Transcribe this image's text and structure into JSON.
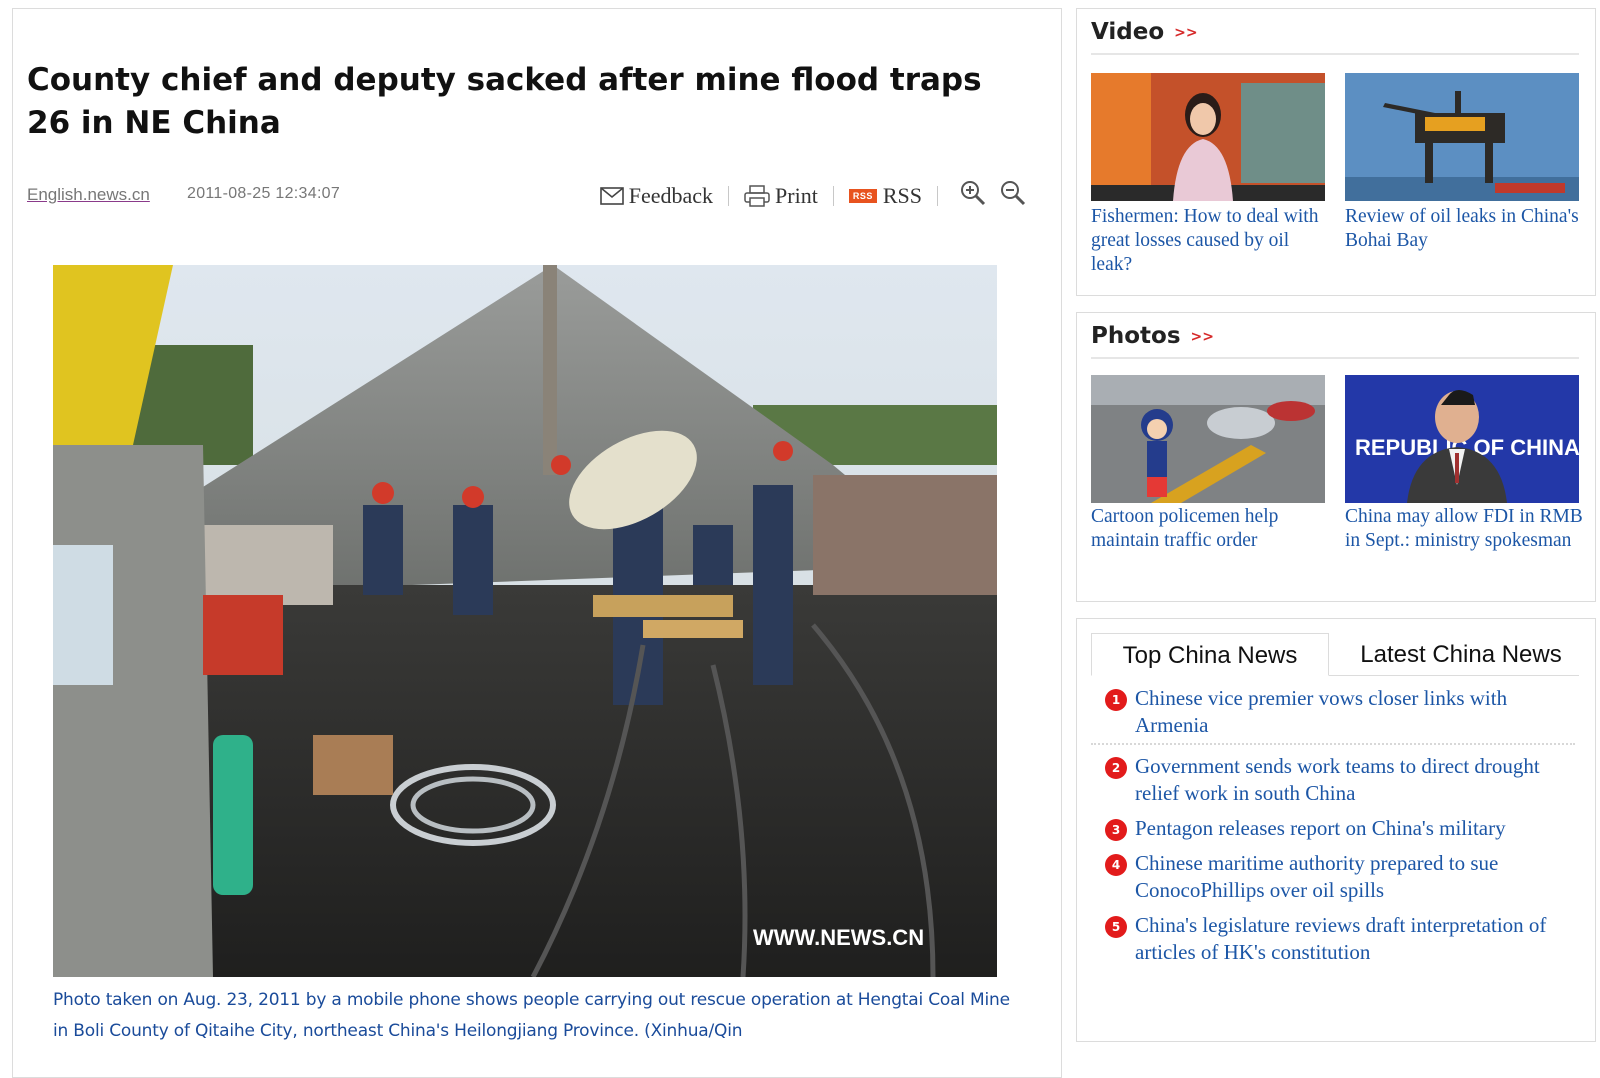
{
  "article": {
    "headline": "County chief and deputy sacked after mine flood traps 26 in NE China",
    "source": "English.news.cn",
    "timestamp": "2011-08-25 12:34:07",
    "tools": {
      "feedback": "Feedback",
      "print": "Print",
      "rss_badge": "RSS",
      "rss": "RSS"
    },
    "photo_watermark": "WWW.NEWS.CN",
    "caption": "Photo taken on Aug. 23, 2011 by a mobile phone shows people carrying out rescue operation at Hengtai Coal Mine in Boli County of Qitaihe City, northeast China's Heilongjiang Province.  (Xinhua/Qin"
  },
  "sidebar": {
    "video": {
      "title": "Video",
      "arrows": ">>",
      "items": [
        {
          "caption": "Fishermen: How to deal with great losses caused by oil leak?"
        },
        {
          "caption": "Review of oil leaks in China's Bohai Bay"
        }
      ]
    },
    "photos": {
      "title": "Photos",
      "arrows": ">>",
      "items": [
        {
          "caption": "Cartoon policemen help maintain traffic order"
        },
        {
          "caption": "China may allow FDI in RMB in Sept.: ministry spokesman"
        }
      ],
      "thumb2_text": "REPUBLIC OF CHINA"
    },
    "news": {
      "tabs": [
        "Top China News",
        "Latest China News"
      ],
      "items": [
        {
          "num": "1",
          "title": "Chinese vice premier vows closer links with Armenia"
        },
        {
          "num": "2",
          "title": "Government sends work teams to direct drought relief work in south China"
        },
        {
          "num": "3",
          "title": "Pentagon releases report on China's military"
        },
        {
          "num": "4",
          "title": "Chinese maritime authority prepared to sue ConocoPhillips over oil spills"
        },
        {
          "num": "5",
          "title": "China's legislature reviews draft interpretation of articles of HK's constitution"
        }
      ]
    }
  },
  "colors": {
    "link_blue": "#1c56a6",
    "caption_blue": "#1a4b9a",
    "accent_red": "#e21b1b",
    "rss_orange": "#e8531f"
  }
}
